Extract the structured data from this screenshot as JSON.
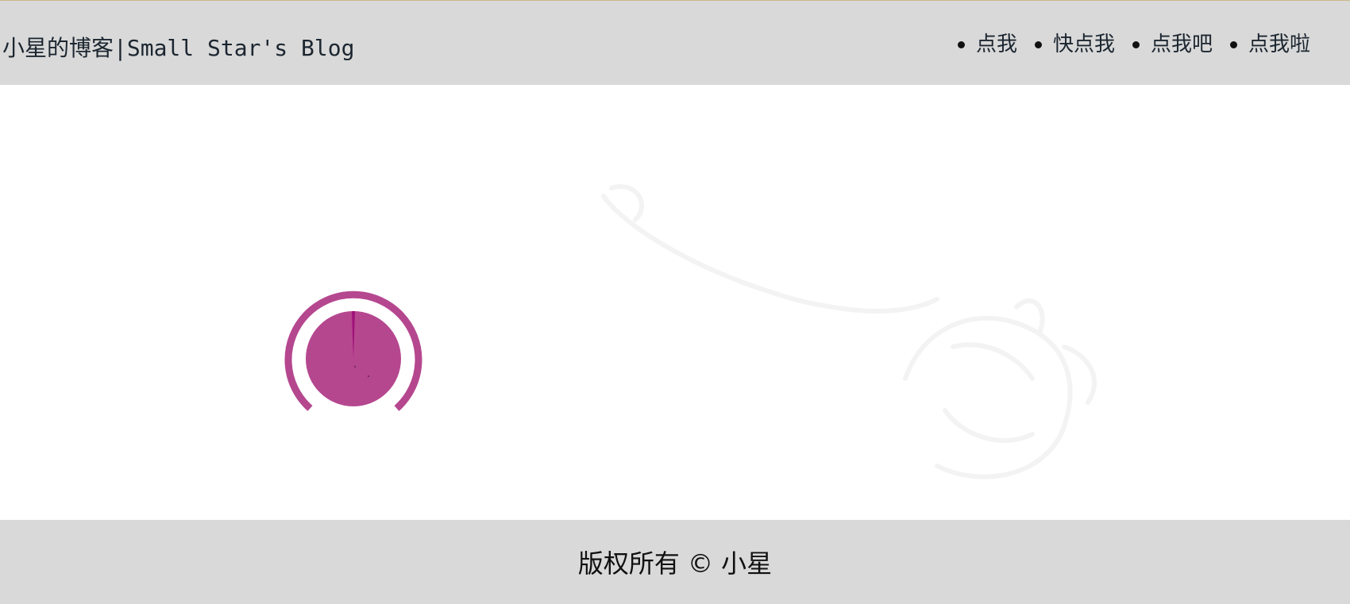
{
  "header": {
    "site_title": "小星的博客|Small Star's Blog",
    "nav": [
      {
        "label": "点我"
      },
      {
        "label": "快点我"
      },
      {
        "label": "点我吧"
      },
      {
        "label": "点我啦"
      }
    ]
  },
  "loader": {
    "icon": "loading-spinner-icon",
    "color": "#b5478f",
    "accent_color": "#a0117a"
  },
  "footer": {
    "copyright": "版权所有 © 小星"
  },
  "colors": {
    "header_bg": "#d9d9d9",
    "footer_bg": "#d9d9d9",
    "text": "#1c2630",
    "page_bg": "#ffffff"
  }
}
